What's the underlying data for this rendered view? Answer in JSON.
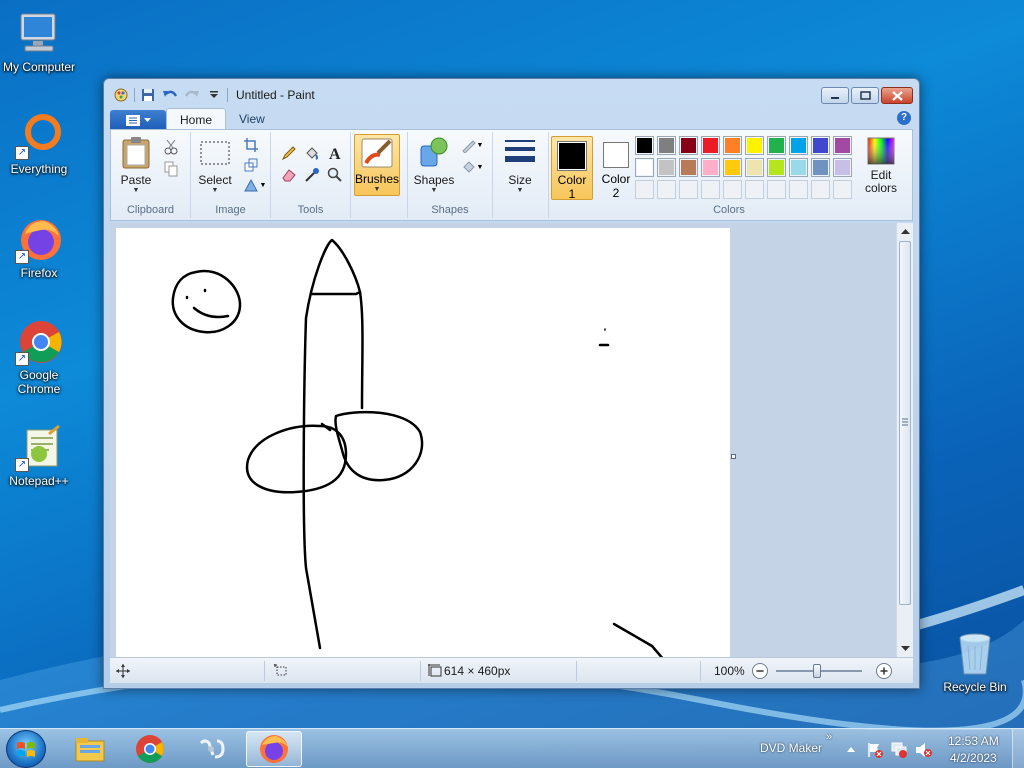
{
  "desktop": {
    "icons": [
      {
        "label": "My Computer"
      },
      {
        "label": "Everything"
      },
      {
        "label": "Firefox"
      },
      {
        "label": "Google Chrome"
      },
      {
        "label": "Notepad++"
      },
      {
        "label": "Recycle Bin"
      }
    ]
  },
  "window": {
    "title": "Untitled - Paint",
    "tabs": [
      {
        "label": "Home"
      },
      {
        "label": "View"
      }
    ],
    "help": "?"
  },
  "ribbon": {
    "clipboard": {
      "label": "Clipboard",
      "paste": "Paste"
    },
    "image": {
      "label": "Image",
      "select": "Select"
    },
    "tools": {
      "label": "Tools"
    },
    "brushes": {
      "label": "Brushes"
    },
    "shapes": {
      "label": "Shapes",
      "shapes_btn": "Shapes"
    },
    "size": {
      "label": "Size"
    },
    "colors": {
      "label": "Colors",
      "color1_line1": "Color",
      "color1_line2": "1",
      "color2_line1": "Color",
      "color2_line2": "2",
      "edit_line1": "Edit",
      "edit_line2": "colors",
      "color1_value": "#000000",
      "color2_value": "#ffffff",
      "palette_row1": [
        "#000000",
        "#7f7f7f",
        "#880015",
        "#ed1c24",
        "#ff7f27",
        "#fff200",
        "#22b14c",
        "#00a2e8",
        "#3f48cc",
        "#a349a4"
      ],
      "palette_row2": [
        "#ffffff",
        "#c3c3c3",
        "#b97a57",
        "#ffaec9",
        "#ffc90e",
        "#efe4b0",
        "#b5e61d",
        "#99d9ea",
        "#7092be",
        "#c8bfe7"
      ]
    }
  },
  "statusbar": {
    "size": "614 × 460px",
    "zoom": "100%"
  },
  "taskbar": {
    "tray_label": "DVD Maker",
    "time": "12:53 AM",
    "date": "4/2/2023"
  }
}
